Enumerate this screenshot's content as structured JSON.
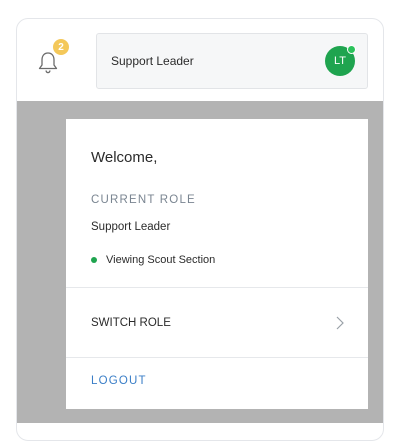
{
  "header": {
    "notification_count": "2",
    "role_label": "Support Leader",
    "avatar_initials": "LT"
  },
  "menu": {
    "welcome": "Welcome,",
    "current_role_heading": "CURRENT ROLE",
    "current_role_value": "Support Leader",
    "viewing_status": "Viewing Scout Section",
    "switch_role_label": "SWITCH ROLE",
    "logout_label": "LOGOUT"
  },
  "icons": {
    "bell": "bell-icon",
    "chevron": "chevron-right-icon"
  },
  "colors": {
    "avatar": "#1fa44f",
    "badge": "#f4c85a",
    "status": "#1fa44f",
    "logout": "#3a7ec7",
    "overlay": "#b3b3b3"
  }
}
